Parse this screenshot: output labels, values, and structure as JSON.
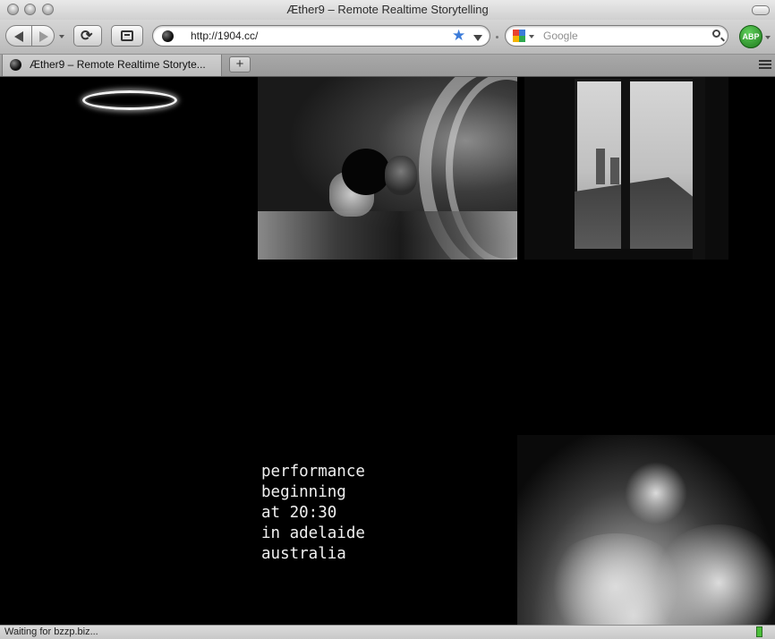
{
  "window": {
    "title": "Æther9 – Remote Realtime Storytelling"
  },
  "toolbar": {
    "url": "http://1904.cc/",
    "search_placeholder": "Google",
    "abp_label": "ABP",
    "reload_glyph": "⟳",
    "star_glyph": "★"
  },
  "tabs": [
    {
      "label": "Æther9 – Remote Realtime Storyte..."
    }
  ],
  "newtab_glyph": "+",
  "content": {
    "performance_lines": [
      "performance",
      "beginning",
      "at 20:30",
      "in adelaide",
      "australia"
    ]
  },
  "status": {
    "text": "Waiting for bzzp.biz..."
  },
  "colors": {
    "page_background": "#000000",
    "status_indicator": "#4cbf3a",
    "star": "#3b7bd9"
  }
}
